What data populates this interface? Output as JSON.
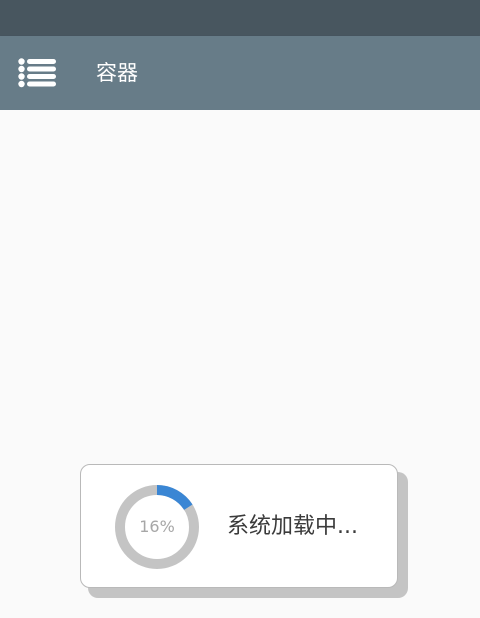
{
  "app_bar": {
    "title": "容器",
    "menu_icon": "menu-list-icon",
    "background_color": "#677c88",
    "status_bar_color": "#48565f"
  },
  "loading": {
    "progress_percent": 16,
    "progress_label": "16%",
    "message": "系统加载中...",
    "progress_color": "#3a86d4",
    "track_color": "#c4c4c4"
  }
}
